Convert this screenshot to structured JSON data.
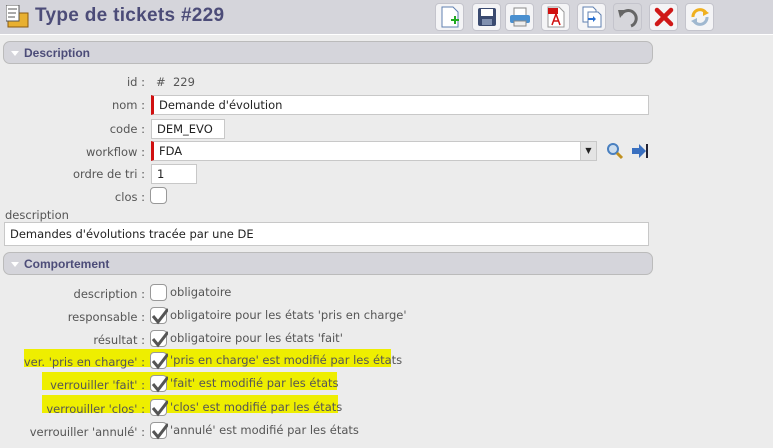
{
  "header": {
    "title": "Type de tickets  #229"
  },
  "toolbar": [
    "new-icon",
    "save-icon",
    "print-icon",
    "pdf-icon",
    "duplicate-icon",
    "undo-icon",
    "delete-icon",
    "refresh-icon"
  ],
  "sections": {
    "description": "Description",
    "behaviour": "Comportement"
  },
  "fields": {
    "id": {
      "label": "id :",
      "value": "#  229"
    },
    "nom": {
      "label": "nom :",
      "value": "Demande d'évolution"
    },
    "code": {
      "label": "code :",
      "value": "DEM_EVO"
    },
    "workflow": {
      "label": "workflow :",
      "value": "FDA"
    },
    "ordre": {
      "label": "ordre de tri :",
      "value": "1"
    },
    "clos": {
      "label": "clos :",
      "checked": false
    },
    "description": {
      "label": "description",
      "value": "Demandes d'évolutions tracée par une DE"
    }
  },
  "behaviour": [
    {
      "label": "description :",
      "text": "obligatoire",
      "checked": false,
      "highlighted": false
    },
    {
      "label": "responsable :",
      "text": "obligatoire pour les états 'pris en charge'",
      "checked": true,
      "highlighted": false
    },
    {
      "label": "résultat :",
      "text": "obligatoire pour les états 'fait'",
      "checked": true,
      "highlighted": false
    },
    {
      "label": "ver. 'pris en charge' :",
      "text": "'pris en charge' est modifié par les états",
      "checked": true,
      "highlighted": true
    },
    {
      "label": "verrouiller 'fait' :",
      "text": "'fait' est modifié par les états",
      "checked": true,
      "highlighted": true
    },
    {
      "label": "verrouiller 'clos' :",
      "text": "'clos' est modifié par les états",
      "checked": true,
      "highlighted": true
    },
    {
      "label": "verrouiller 'annulé' :",
      "text": "'annulé' est modifié par les états",
      "checked": true,
      "highlighted": false
    }
  ],
  "colors": {
    "highlight": "#eeee00",
    "required": "#d01010",
    "title": "#4c4c78"
  }
}
